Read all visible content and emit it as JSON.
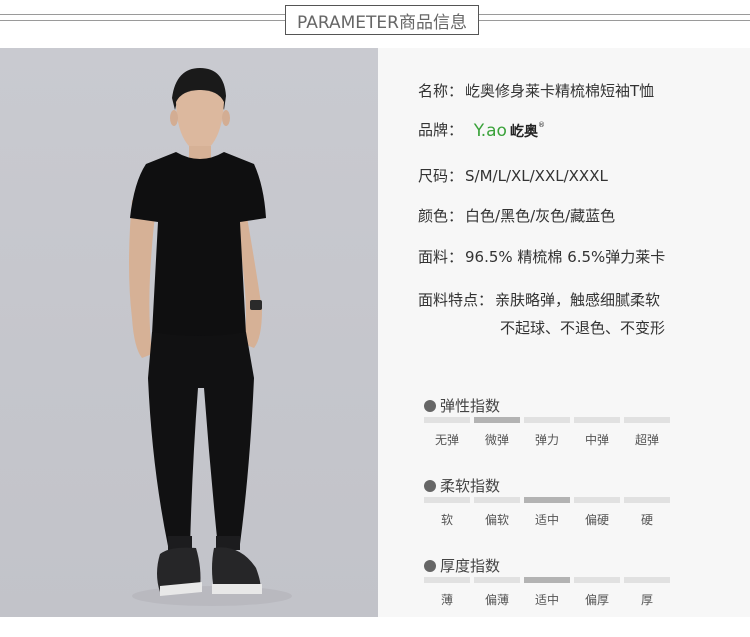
{
  "header": {
    "title": "PARAMETER商品信息"
  },
  "product": {
    "name_label": "名称：",
    "name_value": "屹奥修身莱卡精梳棉短袖T恤",
    "brand_label": "品牌：",
    "brand_logo_latin": "Y.ao",
    "brand_logo_cn": "屹奥",
    "brand_logo_reg": "®",
    "size_label": "尺码：",
    "size_value": "S/M/L/XL/XXL/XXXL",
    "color_label": "颜色：",
    "color_value": "白色/黑色/灰色/藏蓝色",
    "fabric_label": "面料：",
    "fabric_value": "96.5% 精梳棉  6.5%弹力莱卡",
    "feature_label": "面料特点：",
    "feature_line1": "亲肤略弹，触感细腻柔软",
    "feature_line2": "不起球、不退色、不变形"
  },
  "indices": [
    {
      "title": "弹性指数",
      "labels": [
        "无弹",
        "微弹",
        "弹力",
        "中弹",
        "超弹"
      ],
      "selected": 1
    },
    {
      "title": "柔软指数",
      "labels": [
        "软",
        "偏软",
        "适中",
        "偏硬",
        "硬"
      ],
      "selected": 2
    },
    {
      "title": "厚度指数",
      "labels": [
        "薄",
        "偏薄",
        "适中",
        "偏厚",
        "厚"
      ],
      "selected": 2
    }
  ],
  "colors": {
    "logo_green": "#3aa23a",
    "selected_segment": "#b3b3b3",
    "unselected_segment": "#e1e1e1"
  }
}
